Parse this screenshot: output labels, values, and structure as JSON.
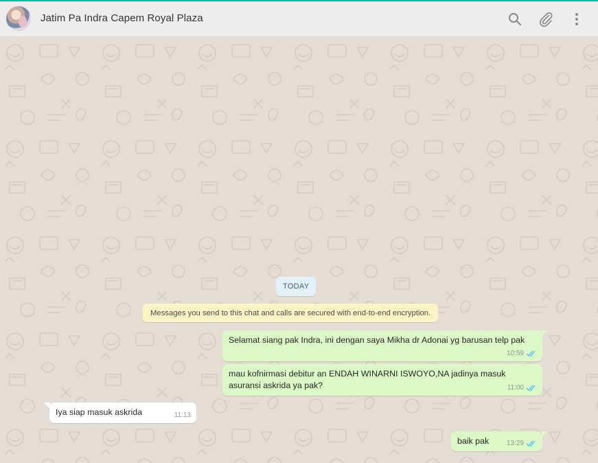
{
  "header": {
    "contact_name": "Jatim Pa Indra Capem Royal Plaza",
    "icons": [
      "search-icon",
      "attach-icon",
      "menu-icon"
    ]
  },
  "chat": {
    "day_label": "TODAY",
    "encryption_notice": "Messages you send to this chat and calls are secured with end-to-end encryption.",
    "messages": [
      {
        "direction": "outgoing",
        "lines": [
          "Selamat siang pak Indra, ini dengan saya Mikha dr Adonai yg barusan telp pak"
        ],
        "time": "10:59",
        "status": "read"
      },
      {
        "direction": "outgoing",
        "lines": [
          "mau kofnirmasi debitur an ENDAH WINARNI ISWOYO,NA jadinya masuk",
          "asuransi askrida ya pak?"
        ],
        "time": "11:00",
        "status": "read"
      },
      {
        "direction": "incoming",
        "lines": [
          "Iya siap masuk askrida"
        ],
        "time": "11:13"
      },
      {
        "direction": "outgoing",
        "lines": [
          "baik pak"
        ],
        "time": "13:29",
        "status": "read"
      }
    ]
  },
  "colors": {
    "accent": "#00bfa5",
    "outgoing_bubble": "#dcf8c6",
    "incoming_bubble": "#ffffff",
    "read_ticks": "#4fc3f7",
    "chat_background": "#e5ddd5"
  }
}
